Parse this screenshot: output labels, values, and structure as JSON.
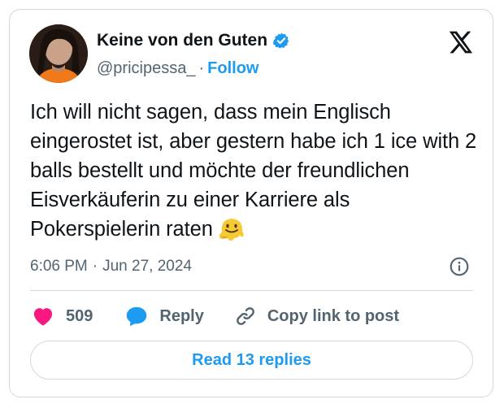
{
  "author": {
    "display_name": "Keine von den Guten",
    "handle": "@pricipessa_",
    "separator": "·",
    "follow_label": "Follow",
    "verified_color": "#1d9bf0"
  },
  "tweet": {
    "text": "Ich will nicht sagen, dass mein Englisch eingerostet ist, aber gestern habe ich 1 ice with 2 balls bestellt und möchte der freundlichen Eisverkäuferin zu einer Karriere als Pokerspielerin raten",
    "emoji": "melting-face-emoji",
    "time": "6:06 PM",
    "date_separator": "·",
    "date": "Jun 27, 2024"
  },
  "actions": {
    "like_count": "509",
    "reply_label": "Reply",
    "copy_link_label": "Copy link to post"
  },
  "read_replies_label": "Read 13 replies",
  "icons": {
    "brand": "x-logo-icon",
    "info": "info-icon",
    "like": "heart-icon",
    "reply": "reply-bubble-icon",
    "copy": "link-icon"
  },
  "colors": {
    "accent": "#1d9bf0",
    "like": "#f91880",
    "text": "#0f1419",
    "muted": "#536471",
    "border": "#cfd9de"
  }
}
